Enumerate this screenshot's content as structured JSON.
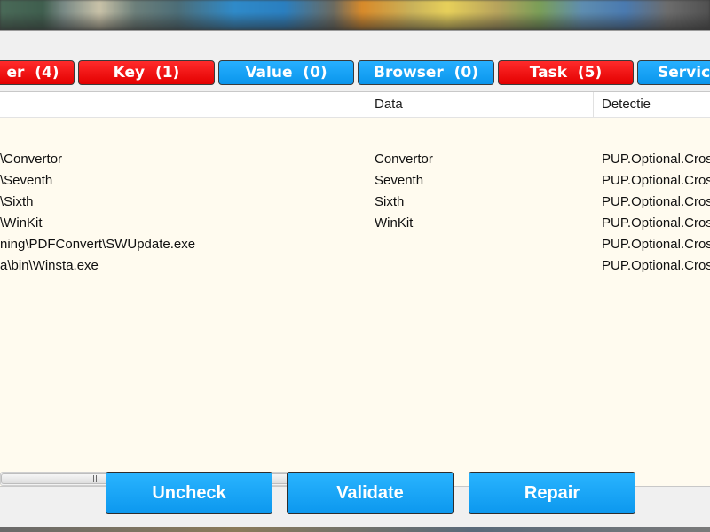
{
  "tabs": [
    {
      "label": "er  (4)",
      "color": "#e30000"
    },
    {
      "label": "Key  (1)",
      "color": "#e30000"
    },
    {
      "label": "Value  (0)",
      "color": "#0a95ec"
    },
    {
      "label": "Browser  (0)",
      "color": "#0a95ec"
    },
    {
      "label": "Task  (5)",
      "color": "#e30000"
    },
    {
      "label": "Servic",
      "color": "#0a95ec"
    }
  ],
  "list": {
    "columns": [
      "",
      "Data",
      "Detectie"
    ],
    "rows": [
      [
        "\\Convertor",
        "Convertor",
        "PUP.Optional.Cros"
      ],
      [
        "\\Seventh",
        "Seventh",
        "PUP.Optional.Cros"
      ],
      [
        "\\Sixth",
        "Sixth",
        "PUP.Optional.Cros"
      ],
      [
        "\\WinKit",
        "WinKit",
        "PUP.Optional.Cros"
      ],
      [
        "ning\\PDFConvert\\SWUpdate.exe",
        "",
        "PUP.Optional.Cros"
      ],
      [
        "a\\bin\\Winsta.exe",
        "",
        "PUP.Optional.Cros"
      ]
    ]
  },
  "scrollbar": {
    "grip_label": "|||"
  },
  "buttons": {
    "uncheck": "Uncheck",
    "validate": "Validate",
    "repair": "Repair"
  }
}
